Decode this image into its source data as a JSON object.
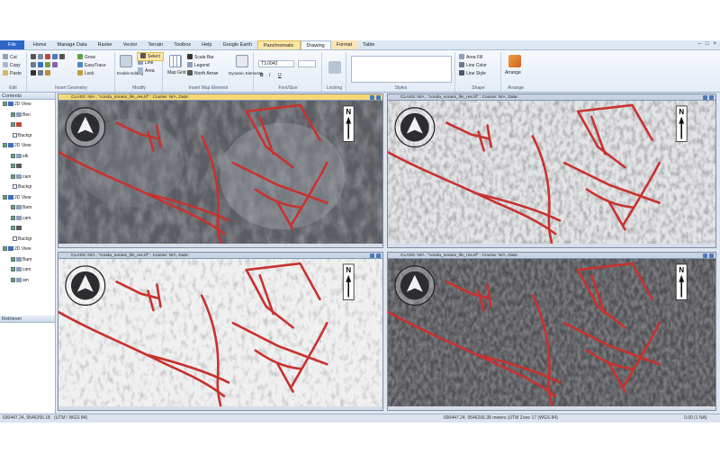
{
  "tabs": [
    "File",
    "Home",
    "Manage Data",
    "Raster",
    "Vector",
    "Terrain",
    "Toolbox",
    "Help",
    "Google Earth",
    "Panchromatic",
    "Drawing",
    "Format",
    "Table"
  ],
  "ribbon": {
    "edit": {
      "label": "Edit",
      "cut": "Cut",
      "copy": "Copy",
      "paste": "Paste"
    },
    "insert": {
      "label": "Insert Geometry",
      "grow": "Grow",
      "easytrace": "EasyTrace",
      "lock": "Lock"
    },
    "modify": {
      "label": "Modify",
      "enable": "Enable Editing",
      "line": "Line",
      "area": "Area"
    },
    "select": {
      "label": "Select"
    },
    "mapel": {
      "label": "Insert Map Element",
      "mapgrid": "Map Grid",
      "scalebar": "Scale Bar",
      "legend": "Legend",
      "north": "North Arrow",
      "dynamic": "Dynamic Elements"
    },
    "font": {
      "label": "Font/Size",
      "font": "T3,0042",
      "bold": "B",
      "italic": "I",
      "under": "U"
    },
    "locking": {
      "label": "Locking"
    },
    "styles": {
      "label": "Styles"
    },
    "shape": {
      "label": "Shape",
      "areafill": "Area Fill",
      "linecolor": "Line Color",
      "linestyle": "Line Style"
    },
    "arrange": {
      "label": "Arrange",
      "arrange": "Arrange"
    }
  },
  "sidebar": {
    "contents_title": "Contents",
    "retriever_title": "Retriever",
    "nodes": [
      "2D View",
      "Ben",
      "",
      "Backgr",
      "2D View",
      "elk",
      "",
      "cam",
      "Backgr",
      "2D View",
      "Bam",
      "cam",
      "",
      "Backgr",
      "2D View",
      "Bam",
      "cam",
      "am"
    ]
  },
  "viewers": [
    {
      "header": "CLASS: N/A , \"conda_norass_llin_res.tif\" : Course: N/A, Date:",
      "active": true,
      "north": "N"
    },
    {
      "header": "CLASS: N/A , \"conda_norass_llin_res.tif\" : Course: N/A, Date:",
      "active": false,
      "north": "N"
    },
    {
      "header": "CLASS: N/A , \"conda_norass_llin_res.tif\" : Course: N/A, Date:",
      "active": false,
      "north": "N"
    },
    {
      "header": "CLASS: N/A , \"conda_norass_llin_res.tif\" : Course: N/A, Date:",
      "active": false,
      "north": "N"
    }
  ],
  "status": {
    "left": "690447.24, 9546266.18",
    "mid": "(UTM / WGS 84)",
    "right": "690447.24, 9546266.38 meters (UTM Zone 17 (WGS 84)",
    "zoom": "0.00 (1 NA)"
  },
  "colors": {
    "fault": "#c8322e",
    "accent": "#2e66c8",
    "active_header": "#f5d873"
  }
}
